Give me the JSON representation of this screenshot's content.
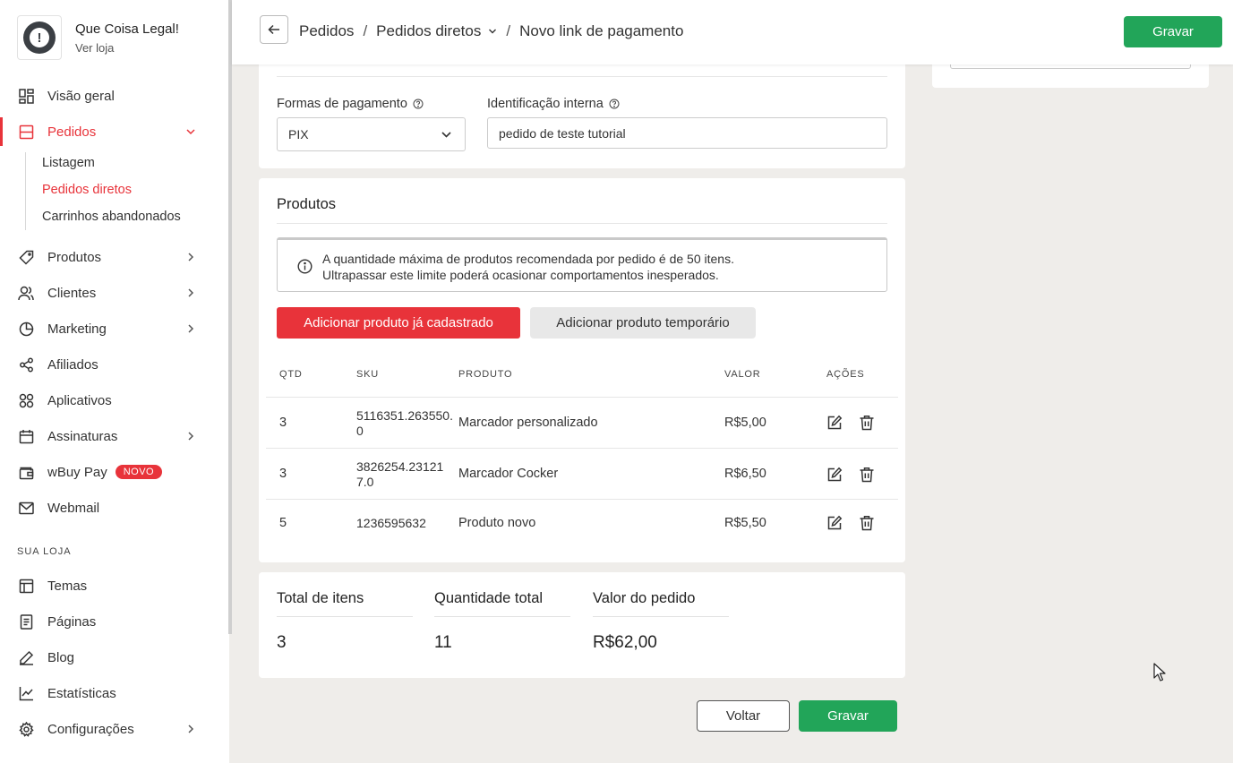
{
  "sidebar": {
    "store_name": "Que Coisa Legal!",
    "store_link": "Ver loja",
    "items": [
      {
        "label": "Visão geral"
      },
      {
        "label": "Pedidos"
      },
      {
        "label": "Produtos"
      },
      {
        "label": "Clientes"
      },
      {
        "label": "Marketing"
      },
      {
        "label": "Afiliados"
      },
      {
        "label": "Aplicativos"
      },
      {
        "label": "Assinaturas"
      },
      {
        "label": "wBuy Pay",
        "badge": "NOVO"
      },
      {
        "label": "Webmail"
      }
    ],
    "pedidos_sub": [
      "Listagem",
      "Pedidos diretos",
      "Carrinhos abandonados"
    ],
    "section_label": "SUA LOJA",
    "store_items": [
      {
        "label": "Temas"
      },
      {
        "label": "Páginas"
      },
      {
        "label": "Blog"
      },
      {
        "label": "Estatísticas"
      },
      {
        "label": "Configurações"
      }
    ]
  },
  "header": {
    "crumbs": [
      "Pedidos",
      "Pedidos diretos",
      "Novo link de pagamento"
    ],
    "save_label": "Gravar"
  },
  "payment": {
    "methods_label": "Formas de pagamento",
    "method_value": "PIX",
    "internal_id_label": "Identificação interna",
    "internal_id_value": "pedido de teste tutorial"
  },
  "products": {
    "title": "Produtos",
    "info_line1": "A quantidade máxima de produtos recomendada por pedido é de 50 itens.",
    "info_line2": "Ultrapassar este limite poderá ocasionar comportamentos inesperados.",
    "add_registered": "Adicionar produto já cadastrado",
    "add_temporary": "Adicionar produto temporário",
    "columns": [
      "QTD",
      "SKU",
      "PRODUTO",
      "VALOR",
      "AÇÕES"
    ],
    "rows": [
      {
        "qtd": "3",
        "sku": "5116351.263550.0",
        "produto": "Marcador personalizado",
        "valor": "R$5,00"
      },
      {
        "qtd": "3",
        "sku": "3826254.231217.0",
        "produto": "Marcador Cocker",
        "valor": "R$6,50"
      },
      {
        "qtd": "5",
        "sku": "1236595632",
        "produto": "Produto novo",
        "valor": "R$5,50"
      }
    ]
  },
  "summary": {
    "total_items_label": "Total de itens",
    "total_items": "3",
    "quantity_label": "Quantidade total",
    "quantity": "11",
    "order_value_label": "Valor do pedido",
    "order_value": "R$62,00"
  },
  "footer": {
    "back_label": "Voltar",
    "save_label": "Gravar"
  },
  "colors": {
    "accent_red": "#e8333a",
    "accent_green": "#22a559"
  }
}
